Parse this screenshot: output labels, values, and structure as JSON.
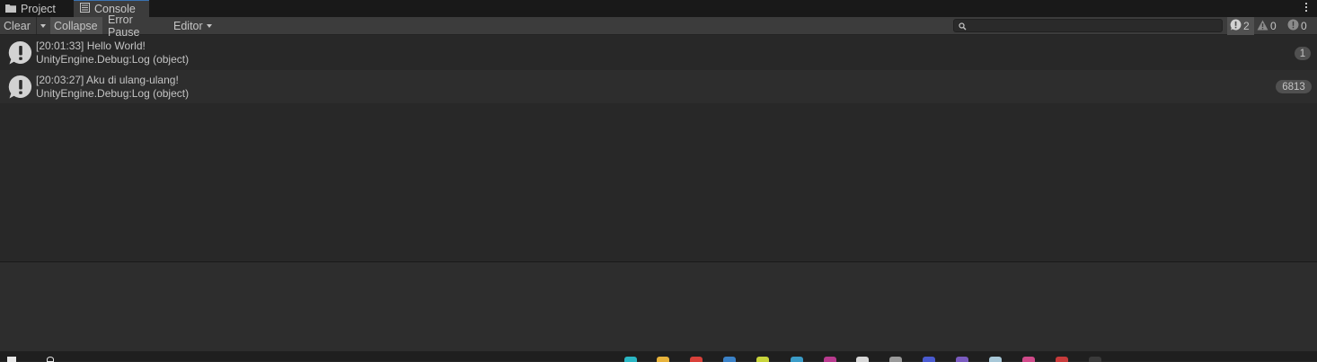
{
  "tabs": [
    {
      "label": "Project",
      "icon": "folder-icon"
    },
    {
      "label": "Console",
      "icon": "console-icon",
      "active": true
    }
  ],
  "toolbar": {
    "clear_label": "Clear",
    "collapse_label": "Collapse",
    "error_pause_label": "Error Pause",
    "editor_label": "Editor"
  },
  "search": {
    "value": "",
    "placeholder": ""
  },
  "counters": {
    "log": "2",
    "warning": "0",
    "error": "0"
  },
  "logs": [
    {
      "line1": "[20:01:33] Hello World!",
      "line2": "UnityEngine.Debug:Log (object)",
      "count": "1"
    },
    {
      "line1": "[20:03:27] Aku di ulang-ulang!",
      "line2": "UnityEngine.Debug:Log (object)",
      "count": "6813"
    }
  ],
  "colors": {
    "background": "#282828",
    "toolbar": "#3c3c3c",
    "tabbar": "#191919",
    "accent": "#3a72b0",
    "text": "#c4c4c4"
  }
}
